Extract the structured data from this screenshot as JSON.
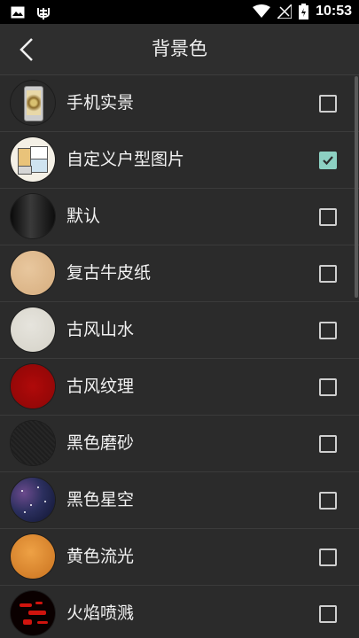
{
  "status_bar": {
    "time": "10:53",
    "left_icons": [
      "image-icon",
      "bug-icon"
    ],
    "right_icons": [
      "wifi-icon",
      "signal-icon",
      "battery-icon"
    ]
  },
  "app_bar": {
    "title": "背景色",
    "back_icon": "back-arrow-icon"
  },
  "colors": {
    "accent_check": "#8dd1c3",
    "background": "#2b2b2b"
  },
  "items": [
    {
      "label": "手机实景",
      "checked": false
    },
    {
      "label": "自定义户型图片",
      "checked": true
    },
    {
      "label": "默认",
      "checked": false
    },
    {
      "label": "复古牛皮纸",
      "checked": false
    },
    {
      "label": "古风山水",
      "checked": false
    },
    {
      "label": "古风纹理",
      "checked": false
    },
    {
      "label": "黑色磨砂",
      "checked": false
    },
    {
      "label": "黑色星空",
      "checked": false
    },
    {
      "label": "黄色流光",
      "checked": false
    },
    {
      "label": "火焰喷溅",
      "checked": false
    }
  ]
}
